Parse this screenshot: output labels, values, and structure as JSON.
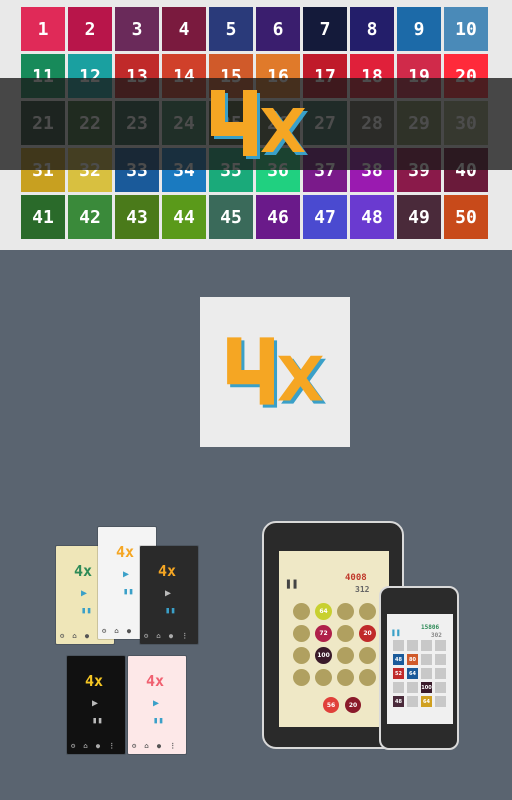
{
  "grid": {
    "tiles": [
      {
        "label": "1",
        "color": "#e02a58"
      },
      {
        "label": "2",
        "color": "#b8154a"
      },
      {
        "label": "3",
        "color": "#6a2a5a"
      },
      {
        "label": "4",
        "color": "#7a1a3e"
      },
      {
        "label": "5",
        "color": "#2a3a7a"
      },
      {
        "label": "6",
        "color": "#3a1e6e"
      },
      {
        "label": "7",
        "color": "#141a3a"
      },
      {
        "label": "8",
        "color": "#231e6a"
      },
      {
        "label": "9",
        "color": "#1c6aa8"
      },
      {
        "label": "10",
        "color": "#4a8ab8"
      },
      {
        "label": "11",
        "color": "#178a5a"
      },
      {
        "label": "12",
        "color": "#1aa0a0"
      },
      {
        "label": "13",
        "color": "#c02a2a"
      },
      {
        "label": "14",
        "color": "#d0402a"
      },
      {
        "label": "15",
        "color": "#d05a2a"
      },
      {
        "label": "16",
        "color": "#e07a2a"
      },
      {
        "label": "17",
        "color": "#c01a2a"
      },
      {
        "label": "18",
        "color": "#e0203a"
      },
      {
        "label": "19",
        "color": "#d02a4a"
      },
      {
        "label": "20",
        "color": "#ff2a3a"
      },
      {
        "label": "21",
        "color": "#2a4a3a"
      },
      {
        "label": "22",
        "color": "#3a6a3a"
      },
      {
        "label": "23",
        "color": "#2a5a4a"
      },
      {
        "label": "24",
        "color": "#3a7a5a"
      },
      {
        "label": "25",
        "color": "#4a5a3a"
      },
      {
        "label": "26",
        "color": "#5a6a4a"
      },
      {
        "label": "27",
        "color": "#3a6a5a"
      },
      {
        "label": "28",
        "color": "#6a6a5a"
      },
      {
        "label": "29",
        "color": "#7a8a5a"
      },
      {
        "label": "30",
        "color": "#9aa27a"
      },
      {
        "label": "31",
        "color": "#c8a020"
      },
      {
        "label": "32",
        "color": "#d8c040"
      },
      {
        "label": "33",
        "color": "#1a5a9a"
      },
      {
        "label": "34",
        "color": "#1a7ac0"
      },
      {
        "label": "35",
        "color": "#1aaa7a"
      },
      {
        "label": "36",
        "color": "#20d080"
      },
      {
        "label": "37",
        "color": "#7a1a8a"
      },
      {
        "label": "38",
        "color": "#9a1ab0"
      },
      {
        "label": "39",
        "color": "#8a1a4a"
      },
      {
        "label": "40",
        "color": "#6a1a3a"
      },
      {
        "label": "41",
        "color": "#2a6a2a"
      },
      {
        "label": "42",
        "color": "#3a8a3a"
      },
      {
        "label": "43",
        "color": "#4a7a1a"
      },
      {
        "label": "44",
        "color": "#5a9a1a"
      },
      {
        "label": "45",
        "color": "#3a6a5a"
      },
      {
        "label": "46",
        "color": "#6a1a8a"
      },
      {
        "label": "47",
        "color": "#4a4ad0"
      },
      {
        "label": "48",
        "color": "#6a3ad0"
      },
      {
        "label": "49",
        "color": "#4a2a3a"
      },
      {
        "label": "50",
        "color": "#c84a1a"
      }
    ]
  },
  "logo": {
    "text": "4x",
    "color": "#f5a623",
    "shadow": "#3aa0c8"
  },
  "themes": [
    {
      "bg": "#efe6b8",
      "logo_color": "#2e8b57"
    },
    {
      "bg": "#f4f4f4",
      "logo_color": "#f5a623"
    },
    {
      "bg": "#2a2a2a",
      "logo_color": "#f5a623"
    },
    {
      "bg": "#111111",
      "logo_color": "#f5c623"
    },
    {
      "bg": "#fde8e8",
      "logo_color": "#f06070"
    }
  ],
  "tablet": {
    "hud_score": "4008",
    "hud_sub": "312",
    "circles": [
      "64",
      "72",
      "20",
      "100"
    ],
    "bottom": [
      "56",
      "20"
    ]
  },
  "phone": {
    "hud_score": "15806",
    "hud_sub": "302",
    "tiles": [
      "48",
      "80",
      "52",
      "64",
      "100",
      "48",
      "64"
    ]
  }
}
